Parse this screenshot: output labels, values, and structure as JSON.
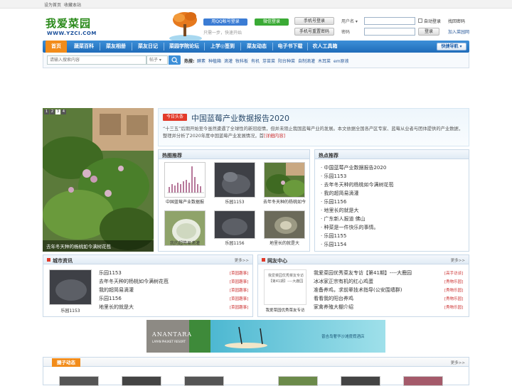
{
  "topbar": {
    "set_home": "设为首页",
    "favorite": "收藏本站"
  },
  "header": {
    "logo_text": "我爱菜园",
    "logo_url": "WWW.YZCI.COM",
    "qq_login": "用QQ帐号登录",
    "wx_login": "微信登录",
    "tree_caption": "只需一步，快速开始",
    "phone_login": "手机号登录",
    "phone_reset": "手机号重置密码",
    "username_label": "用户名 ▾",
    "password_label": "密码",
    "auto_login": "自动登录",
    "login_btn": "登录",
    "forgot": "找回密码",
    "join": "加入菜园网"
  },
  "nav": {
    "items": [
      "首页",
      "蔬菜百科",
      "菜友相册",
      "菜友日记",
      "菜园学院论坛",
      "上学◎签到",
      "菜友动态",
      "电子书下载",
      "农人工具箱"
    ],
    "quick": "快捷导航 ▾"
  },
  "search": {
    "placeholder": "请输入搜索内容",
    "scope": "帖子 ▾",
    "hot_label": "热搜:",
    "hot": [
      "酵素",
      "种植箱",
      "滴灌",
      "牧科板",
      "有机",
      "芽苗菜",
      "阳台种菜",
      "自制滴灌",
      "木耳菜",
      "em原液"
    ]
  },
  "slider": {
    "pages": [
      "1",
      "2",
      "3",
      "4"
    ],
    "active": 3,
    "caption": "去年冬天种的杨桃如今满树花苞"
  },
  "headline": {
    "badge": "今日头条",
    "title": "中国蓝莓产业数据报告2020",
    "body": "“十三五”后期开始至今虽然遭遇了全球性的新冠疫情，但并未阻止我国蓝莓产业的发展。本文依据全国各产区专家、蓝莓从业者与团体提供的产业数据，整理并分析了2020年度中国蓝莓产业发展情况，首",
    "detail": "[详细内容]"
  },
  "hot_recommend": {
    "title": "热图推荐",
    "items": [
      {
        "caption": "中国蓝莓产业数据报"
      },
      {
        "caption": "乐园1153"
      },
      {
        "caption": "去年冬天种的杨桃如今"
      },
      {
        "caption": "我的超简易滴灌"
      },
      {
        "caption": "乐园1156"
      },
      {
        "caption": "地里长的就是大"
      }
    ]
  },
  "hot_list": {
    "title": "热点推荐",
    "items": [
      "中国蓝莓产业数据报告2020",
      "乐园1153",
      "去年冬天种的杨桃如今满树花苞",
      "我的超简易滴灌",
      "乐园1156",
      "地里长的就是大",
      "广东新人报道 佛山",
      "种菜是一件快乐的事情。",
      "乐园1155",
      "乐园1154"
    ]
  },
  "city": {
    "title": "城市资讯",
    "more": "更多>>",
    "thumb_caption": "乐园1153",
    "items": [
      {
        "text": "乐园1153",
        "tag": "[菜园趣事]"
      },
      {
        "text": "去年冬天种的杨桃如今满树花苞",
        "tag": "[菜园趣事]"
      },
      {
        "text": "我的超简易滴灌",
        "tag": "[菜园趣事]"
      },
      {
        "text": "乐园1156",
        "tag": "[菜园趣事]"
      },
      {
        "text": "地里长的就是大",
        "tag": "[菜园趣事]"
      }
    ]
  },
  "friends": {
    "title": "网友中心",
    "more": "更多>>",
    "thumb_text": "我爱菜园优秀菜友专访【第41期】----大鹿园",
    "thumb_caption": "我爱菜园优秀菜友专访",
    "items": [
      {
        "text": "我爱菜园优秀菜友专访【第41期】----大鹿园",
        "tag": "[高手访谈]"
      },
      {
        "text": "冰冰家正宗有机的红心鸡蛋",
        "tag": "[秀物乐园]"
      },
      {
        "text": "准备养鸡，求前辈技术指导(公安围墙群)",
        "tag": "[秀物乐园]"
      },
      {
        "text": "看看我的阳台养鸡",
        "tag": "[秀物乐园]"
      },
      {
        "text": "家禽养殖大棚介绍",
        "tag": "[秀物乐园]"
      }
    ]
  },
  "ad": {
    "brand": "ANANTARA",
    "sub": "LAYAN PHUKET RESORT",
    "text": "普吉岛奢华沙滩度假酒店"
  },
  "groups": {
    "title": "圈子动态",
    "more": "更多>>"
  },
  "colors": {
    "nav": "#2a78c6",
    "accent": "#f28c1a",
    "tag": "#cc3333",
    "link": "#2a5a9a"
  }
}
